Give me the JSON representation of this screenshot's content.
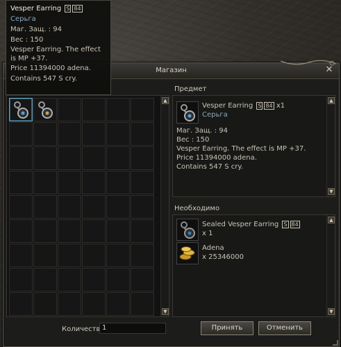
{
  "tooltip": {
    "name": "Vesper Earring",
    "grade": "S",
    "grade_level": "84",
    "type": "Серьга",
    "mdef": "Маг. Защ. : 94",
    "weight": "Вес : 150",
    "desc": "Vesper Earring. The effect is MP +37.",
    "price": "Price 11394000 adena.",
    "contains": "Contains 547 S cry."
  },
  "window": {
    "title": "Магазин",
    "item_section_label": "Предмет",
    "required_section_label": "Необходимо"
  },
  "selected_item": {
    "name": "Vesper Earring",
    "grade": "S",
    "grade_level": "84",
    "count": "x1",
    "type": "Серьга",
    "mdef": "Маг. Защ. : 94",
    "weight": "Вес : 150",
    "desc": "Vesper Earring. The effect is MP +37.",
    "price": "Price 11394000 adena.",
    "contains": "Contains 547 S cry."
  },
  "required": [
    {
      "name": "Sealed Vesper Earring",
      "grade": "S",
      "grade_level": "84",
      "count": "x 1",
      "icon": "sealed-earring-icon"
    },
    {
      "name": "Adena",
      "count": "x 25346000",
      "icon": "adena-icon"
    }
  ],
  "footer": {
    "quantity_label": "Количеств",
    "quantity_value": "1",
    "accept_label": "Принять",
    "cancel_label": "Отменить"
  },
  "colors": {
    "accent_border": "#8a8472",
    "selected_cell": "#6aa0b8",
    "item_type_text": "#8aa9bc"
  }
}
